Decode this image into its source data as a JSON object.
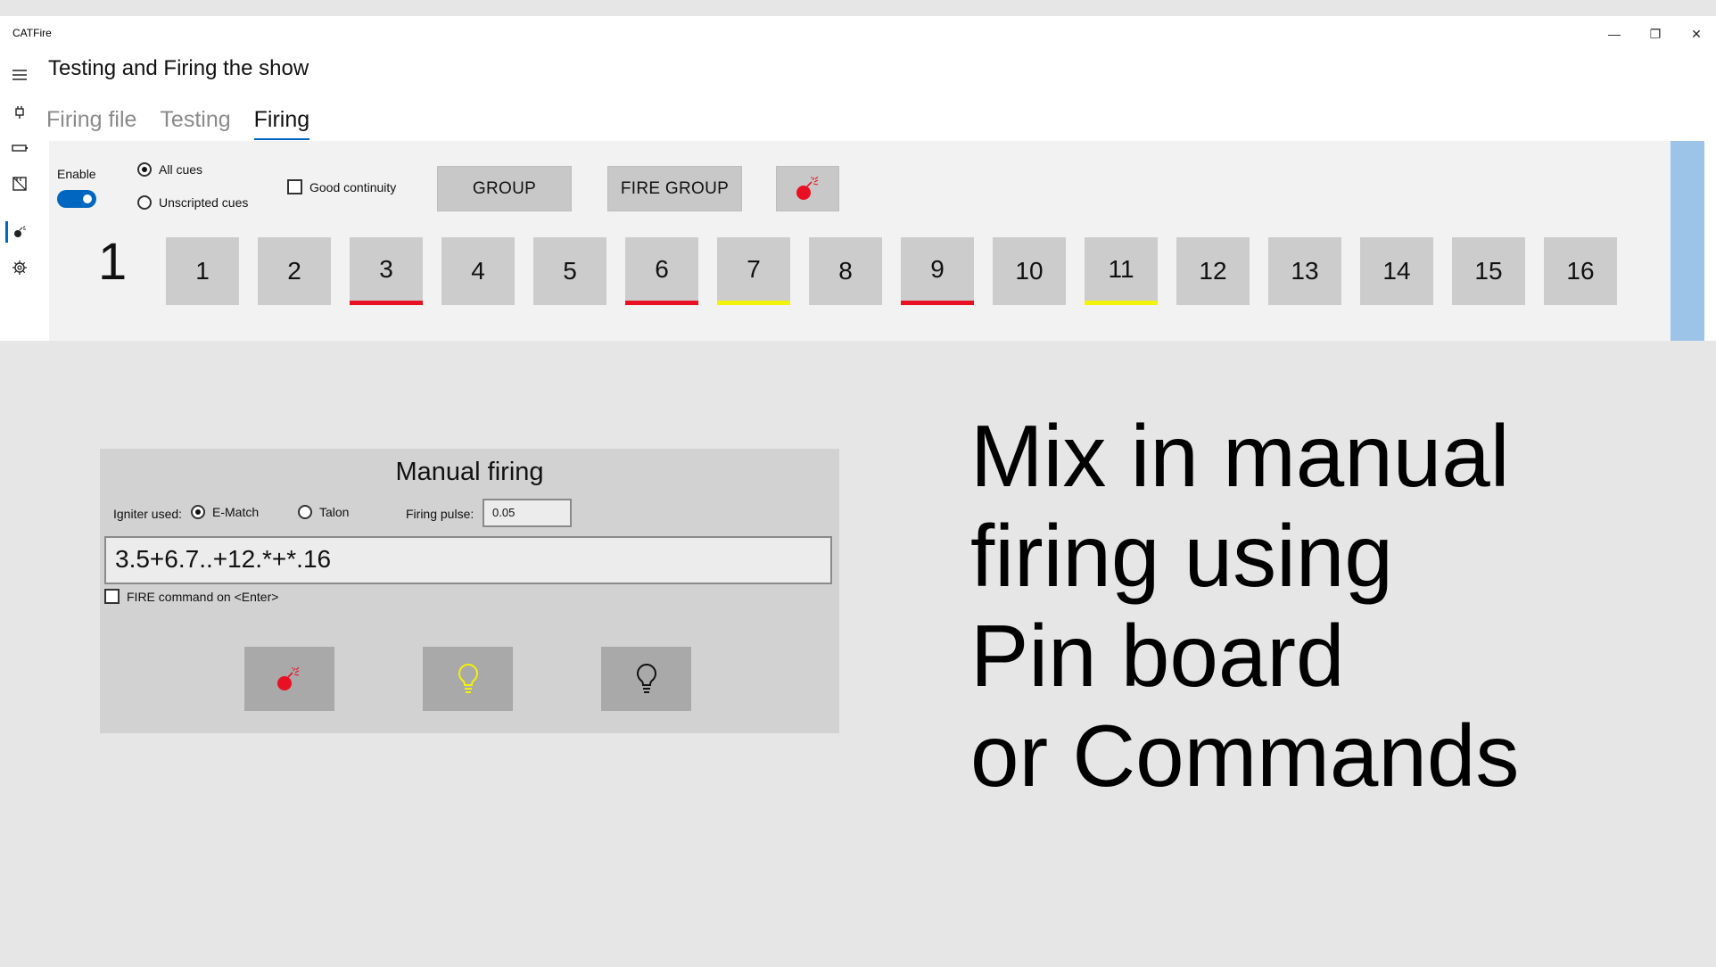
{
  "window": {
    "app_title": "CATFire",
    "controls": {
      "minimize": "—",
      "restore": "❐",
      "close": "✕"
    }
  },
  "page": {
    "title": "Testing and Firing the show",
    "tabs": [
      {
        "label": "Firing file",
        "active": false
      },
      {
        "label": "Testing",
        "active": false
      },
      {
        "label": "Firing",
        "active": true
      }
    ]
  },
  "sidebar": {
    "items": [
      {
        "icon": "hamburger-menu-icon"
      },
      {
        "icon": "plug-icon"
      },
      {
        "icon": "battery-icon"
      },
      {
        "icon": "ruler-icon"
      },
      {
        "icon": "bomb-icon"
      },
      {
        "icon": "gear-icon"
      }
    ]
  },
  "firing_panel": {
    "enable_label": "Enable",
    "enable_on": true,
    "radio_all_cues": "All cues",
    "radio_unscripted": "Unscripted cues",
    "good_continuity": "Good continuity",
    "group_button": "GROUP",
    "fire_group_button": "FIRE GROUP",
    "group_number": "1",
    "cues": [
      {
        "label": "1",
        "status": "none"
      },
      {
        "label": "2",
        "status": "none"
      },
      {
        "label": "3",
        "status": "red"
      },
      {
        "label": "4",
        "status": "none"
      },
      {
        "label": "5",
        "status": "none"
      },
      {
        "label": "6",
        "status": "red"
      },
      {
        "label": "7",
        "status": "yellow"
      },
      {
        "label": "8",
        "status": "none"
      },
      {
        "label": "9",
        "status": "red"
      },
      {
        "label": "10",
        "status": "none"
      },
      {
        "label": "11",
        "status": "yellow"
      },
      {
        "label": "12",
        "status": "none"
      },
      {
        "label": "13",
        "status": "none"
      },
      {
        "label": "14",
        "status": "none"
      },
      {
        "label": "15",
        "status": "none"
      },
      {
        "label": "16",
        "status": "none"
      }
    ],
    "colors": {
      "accent": "#0067c0",
      "red": "#e81123",
      "yellow": "#f2f20a"
    }
  },
  "manual": {
    "title": "Manual firing",
    "igniter_label": "Igniter used:",
    "igniter_ematch": "E-Match",
    "igniter_talon": "Talon",
    "pulse_label": "Firing pulse:",
    "pulse_value": "0.05",
    "command_value": "3.5+6.7..+12.*+*.16",
    "fire_on_enter": "FIRE command on <Enter>"
  },
  "promo": {
    "line1": "Mix in manual",
    "line2": "firing using",
    "line3": "Pin board",
    "line4": "or Commands"
  }
}
